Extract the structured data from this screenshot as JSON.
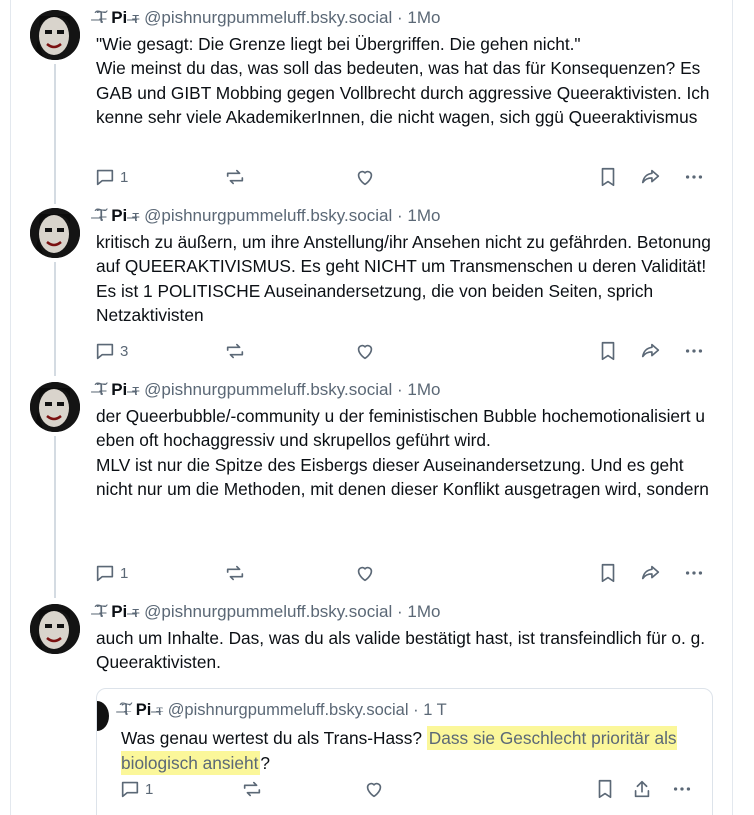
{
  "author": {
    "display_name": "Pi",
    "name_deco_left": "̶͠Ⲧ̶",
    "name_deco_right": "̶ⲧ̶",
    "handle": "@pishnurgpummeluff.bsky.social"
  },
  "posts": [
    {
      "time": "1Mo",
      "lines": [
        "\"Wie gesagt: Die Grenze liegt bei Übergriffen. Die gehen nicht.\"",
        "Wie meinst du das, was soll das bedeuten, was hat das für Konsequenzen? Es GAB und GIBT Mobbing gegen Vollbrecht durch aggressive Queeraktivisten. Ich kenne sehr viele AkademikerInnen, die nicht wagen, sich ggü Queeraktivismus"
      ],
      "reply_count": "1"
    },
    {
      "time": "1Mo",
      "lines": [
        "kritisch zu äußern, um ihre Anstellung/ihr Ansehen nicht zu gefährden. Betonung auf QUEERAKTIVISMUS. Es geht NICHT um Transmenschen u deren Validität! Es ist 1 POLITISCHE Auseinandersetzung, die von beiden Seiten, sprich Netzaktivisten"
      ],
      "reply_count": "3"
    },
    {
      "time": "1Mo",
      "lines": [
        "der Queerbubble/-community u der feministischen Bubble hochemotionalisiert u eben oft hochaggressiv und skrupellos geführt wird.",
        "MLV ist nur die Spitze des Eisbergs dieser Auseinandersetzung. Und es geht nicht nur um die Methoden, mit denen dieser Konflikt ausgetragen wird, sondern"
      ],
      "reply_count": "1"
    },
    {
      "time": "1Mo",
      "lines": [
        "auch um Inhalte. Das, was du als valide bestätigt hast, ist transfeindlich für o. g. Queeraktivisten."
      ],
      "reply_count": ""
    }
  ],
  "quote": {
    "time": "1 T",
    "text_plain": "Was genau wertest du als Trans-Hass? ",
    "text_highlight": "Dass sie Geschlecht prioritär als biologisch ansieht",
    "text_end": "?",
    "reply_count": "1",
    "highlight_color": "#fbf79a"
  },
  "separator": "·",
  "colors": {
    "muted": "#5b6876",
    "text": "#0b0f14",
    "thread_line": "#d4dbe2",
    "border": "#e3e8ee"
  },
  "icons": [
    "reply-icon",
    "repost-icon",
    "like-icon",
    "bookmark-icon",
    "share-icon",
    "more-icon",
    "upload-icon"
  ]
}
